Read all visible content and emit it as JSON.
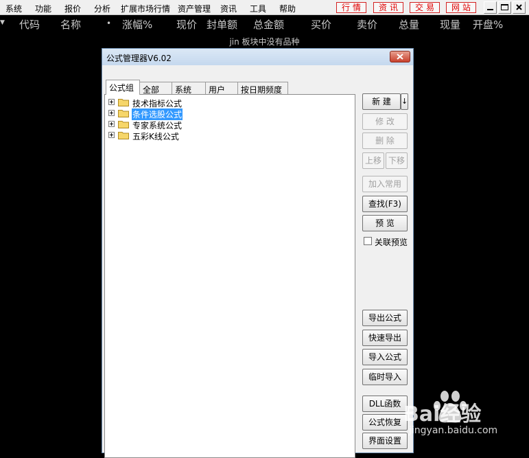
{
  "menubar": {
    "items": [
      "系统",
      "功能",
      "报价",
      "分析",
      "扩展市场行情",
      "资产管理",
      "资讯",
      "工具",
      "帮助"
    ],
    "site_buttons": [
      "行情",
      "资讯",
      "交易",
      "网站"
    ]
  },
  "columns": {
    "labels": [
      "代码",
      "名称",
      "•",
      "涨幅%",
      "现价",
      "封单额",
      "总金额",
      "买价",
      "卖价",
      "总量",
      "现量",
      "开盘%"
    ]
  },
  "status": {
    "message": "jin 板块中没有品种"
  },
  "dialog": {
    "title": "公式管理器V6.02",
    "tabs": [
      "公式组",
      "全部",
      "系统",
      "用户",
      "按日期频度"
    ],
    "tree": [
      "技术指标公式",
      "条件选股公式",
      "专家系统公式",
      "五彩K线公式"
    ],
    "selected_node": "条件选股公式",
    "buttons": {
      "new": "新 建",
      "new_arrow": "↓",
      "modify": "修 改",
      "delete": "删 除",
      "move_up": "上移",
      "move_down": "下移",
      "add_common": "加入常用",
      "find": "查找(F3)",
      "preview": "预 览",
      "export": "导出公式",
      "quick_export": "快速导出",
      "import": "导入公式",
      "temp_import": "临时导入",
      "dll": "DLL函数",
      "restore": "公式恢复",
      "ui_settings": "界面设置"
    },
    "link_preview_label": "关联预览"
  },
  "watermark": {
    "text_main": "Bai经验",
    "text_url": "jingyan.baidu.com"
  },
  "colors": {
    "background": "#000000",
    "header_text": "#c8c8c8",
    "site_button_red": "#e00000",
    "selection_blue": "#3399ff",
    "title_gradient": "#c5d8ee"
  }
}
